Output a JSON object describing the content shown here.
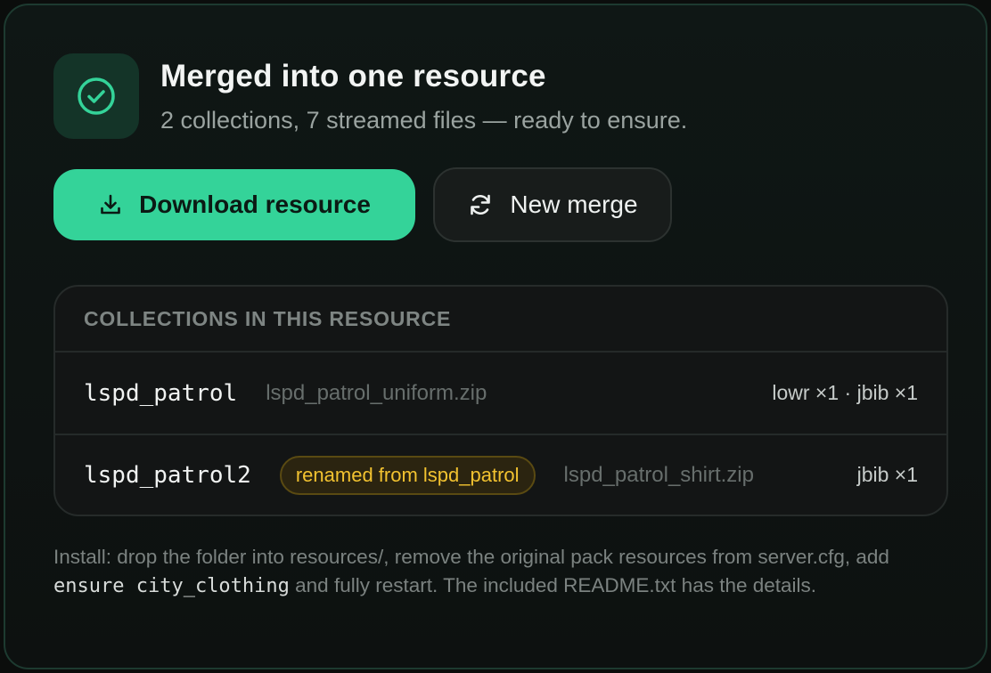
{
  "header": {
    "title": "Merged into one resource",
    "subtitle": "2 collections, 7 streamed files — ready to ensure.",
    "status_icon": "check-circle-icon"
  },
  "actions": {
    "download_label": "Download resource",
    "download_icon": "download-icon",
    "new_merge_label": "New merge",
    "new_merge_icon": "refresh-icon"
  },
  "collections": {
    "heading": "COLLECTIONS IN THIS RESOURCE",
    "rows": [
      {
        "name": "lspd_patrol",
        "file": "lspd_patrol_uniform.zip",
        "meta": "lowr ×1 · jbib ×1"
      },
      {
        "name": "lspd_patrol2",
        "badge": "renamed from lspd_patrol",
        "file": "lspd_patrol_shirt.zip",
        "meta": "jbib ×1"
      }
    ]
  },
  "install": {
    "text_before": "Install: drop the folder into resources/, remove the original pack resources from server.cfg, add ",
    "code": "ensure city_clothing",
    "text_after": " and fully restart. The included README.txt has the details."
  },
  "colors": {
    "accent": "#34d399",
    "warning": "#f2c230",
    "background": "#0b0d0c"
  }
}
